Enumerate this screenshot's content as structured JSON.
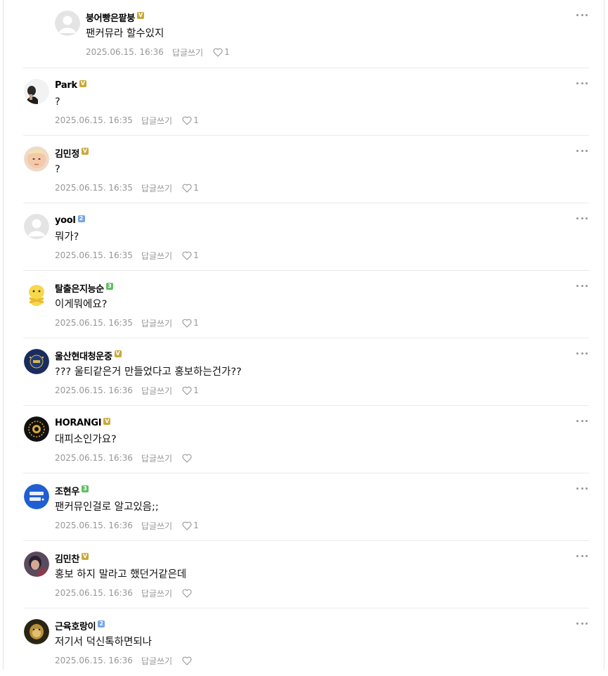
{
  "comments": [
    {
      "nick": "붕어빵은팥붕",
      "badge": "V",
      "badge_color": "#c9a93c",
      "text": "팬커뮤라 할수있지",
      "date": "2025.06.15. 16:36",
      "reply": "답글쓰기",
      "likes": "1",
      "avatar": "default-avatar",
      "is_reply": true
    },
    {
      "nick": "Park",
      "badge": "V",
      "badge_color": "#c9a93c",
      "text": "?",
      "date": "2025.06.15. 16:35",
      "reply": "답글쓰기",
      "likes": "1",
      "avatar": "profile-photo"
    },
    {
      "nick": "김민정",
      "badge": "V",
      "badge_color": "#c9a93c",
      "text": "?",
      "date": "2025.06.15. 16:35",
      "reply": "답글쓰기",
      "likes": "1",
      "avatar": "profile-photo"
    },
    {
      "nick": "yool",
      "badge": "2",
      "badge_color": "#73a4e6",
      "text": "뭐가?",
      "date": "2025.06.15. 16:35",
      "reply": "답글쓰기",
      "likes": "1",
      "avatar": "default-avatar"
    },
    {
      "nick": "탈출은지능순",
      "badge": "3",
      "badge_color": "#5fbf5f",
      "text": "이게뭐에요?",
      "date": "2025.06.15. 16:35",
      "reply": "답글쓰기",
      "likes": "1",
      "avatar": "character-avatar"
    },
    {
      "nick": "울산현대청운중",
      "badge": "V",
      "badge_color": "#c9a93c",
      "text": "??? 울티같은거 만들었다고 홍보하는건가??",
      "date": "2025.06.15. 16:36",
      "reply": "답글쓰기",
      "likes": "1",
      "avatar": "emblem-avatar"
    },
    {
      "nick": "HORANGI",
      "badge": "V",
      "badge_color": "#c9a93c",
      "text": "대피소인가요?",
      "date": "2025.06.15. 16:36",
      "reply": "답글쓰기",
      "likes": "",
      "avatar": "emblem-avatar"
    },
    {
      "nick": "조현우",
      "badge": "3",
      "badge_color": "#5fbf5f",
      "text": "팬커뮤인걸로 알고있음;;",
      "date": "2025.06.15. 16:36",
      "reply": "답글쓰기",
      "likes": "1",
      "avatar": "logo-avatar"
    },
    {
      "nick": "김민찬",
      "badge": "V",
      "badge_color": "#c9a93c",
      "text": "홍보 하지 말라고 했던거같은데",
      "date": "2025.06.15. 16:36",
      "reply": "답글쓰기",
      "likes": "",
      "avatar": "profile-photo"
    },
    {
      "nick": "근육호랑이",
      "badge": "2",
      "badge_color": "#73a4e6",
      "text": "저기서 덕신톡하면되나",
      "date": "2025.06.15. 16:36",
      "reply": "답글쓰기",
      "likes": "",
      "avatar": "profile-photo"
    }
  ],
  "icons": {
    "like": "heart-outline-icon",
    "more": "more-dots-icon"
  }
}
